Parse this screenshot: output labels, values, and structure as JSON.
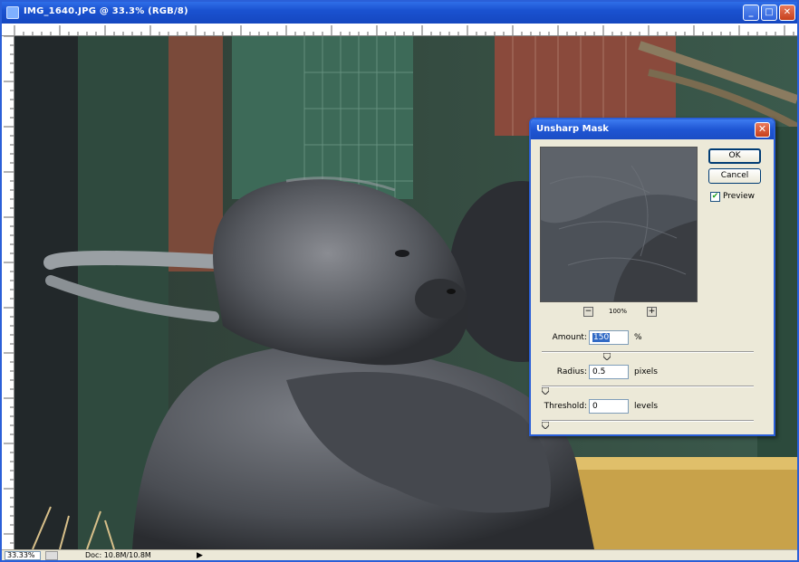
{
  "window": {
    "title": "IMG_1640.JPG @ 33.3% (RGB/8)",
    "minimize": "_",
    "maximize": "□",
    "close": "✕"
  },
  "statusbar": {
    "zoom": "33.33%",
    "doc_size": "Doc: 10.8M/10.8M",
    "menu_arrow": "▶"
  },
  "dialog": {
    "title": "Unsharp Mask",
    "close": "✕",
    "ok_label": "OK",
    "cancel_label": "Cancel",
    "preview_label": "Preview",
    "preview_checked": true,
    "preview_zoom": "100%",
    "zoom_out": "−",
    "zoom_in": "+",
    "amount": {
      "label": "Amount:",
      "value": "150",
      "unit": "%",
      "slider_fraction": 0.3
    },
    "radius": {
      "label": "Radius:",
      "value": "0.5",
      "unit": "pixels",
      "slider_fraction": 0.0
    },
    "threshold": {
      "label": "Threshold:",
      "value": "0",
      "unit": "levels",
      "slider_fraction": 0.0
    }
  },
  "icons": {
    "app": "photoshop-doc-icon",
    "check": "checkmark-icon",
    "slider": "slider-thumb-icon"
  },
  "colors": {
    "titlebar": "#1a52d0",
    "close_button": "#c7401c",
    "dialog_bg": "#ece9d8",
    "selection": "#316ac5"
  }
}
